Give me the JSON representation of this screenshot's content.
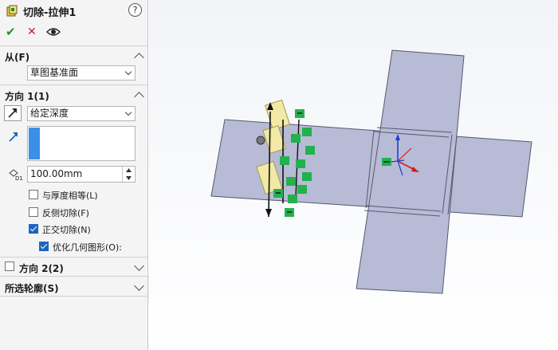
{
  "panel": {
    "title": "切除-拉伸1",
    "help_glyph": "?",
    "actions": {
      "ok": "✔",
      "cancel": "✕",
      "preview": "👁"
    },
    "from": {
      "header": "从(F)",
      "value": "草图基准面"
    },
    "direction1": {
      "header": "方向 1(1)",
      "end_condition": "给定深度",
      "depth": "100.00mm",
      "depth_icon_label": "D1",
      "options": [
        {
          "label": "与厚度相等(L)",
          "checked": false
        },
        {
          "label": "反侧切除(F)",
          "checked": false
        },
        {
          "label": "正交切除(N)",
          "checked": true
        },
        {
          "label": "优化几何图形(O):",
          "checked": true
        }
      ]
    },
    "direction2": {
      "header": "方向 2(2)",
      "checked": false
    },
    "contours": {
      "header": "所选轮廓(S)"
    }
  },
  "colors": {
    "accent": "#1c64c2",
    "ok": "#1a9a1a",
    "cancel": "#c82020",
    "face": "#b7bbd6",
    "tag": "#22b14c"
  }
}
